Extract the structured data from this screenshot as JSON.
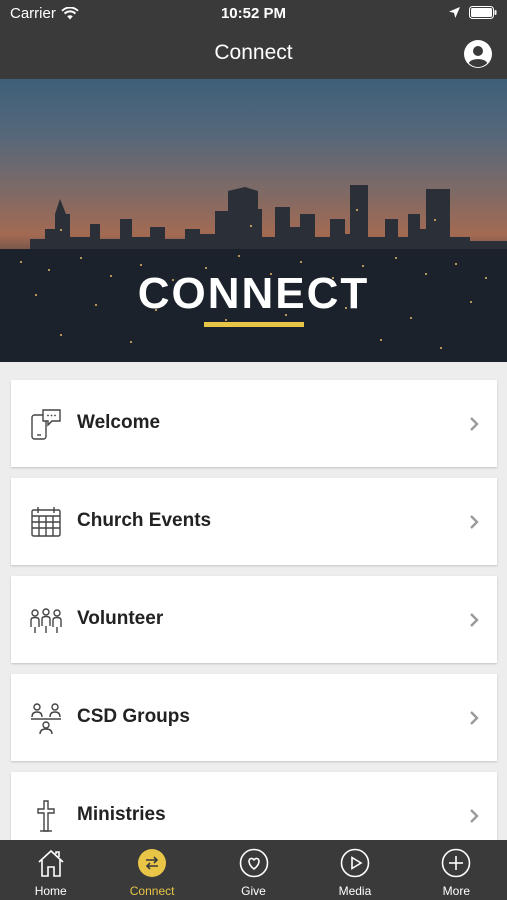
{
  "status": {
    "carrier": "Carrier",
    "time": "10:52 PM"
  },
  "header": {
    "title": "Connect"
  },
  "hero": {
    "title": "CONNECT",
    "accent_color": "#e8c547"
  },
  "menu": [
    {
      "label": "Welcome",
      "icon": "phone-chat-icon"
    },
    {
      "label": "Church Events",
      "icon": "calendar-icon"
    },
    {
      "label": "Volunteer",
      "icon": "people-group-icon"
    },
    {
      "label": "CSD Groups",
      "icon": "group-meeting-icon"
    },
    {
      "label": "Ministries",
      "icon": "cross-icon"
    }
  ],
  "tabs": [
    {
      "label": "Home",
      "icon": "home-icon",
      "active": false
    },
    {
      "label": "Connect",
      "icon": "swap-arrows-icon",
      "active": true
    },
    {
      "label": "Give",
      "icon": "heart-icon",
      "active": false
    },
    {
      "label": "Media",
      "icon": "play-icon",
      "active": false
    },
    {
      "label": "More",
      "icon": "plus-icon",
      "active": false
    }
  ]
}
